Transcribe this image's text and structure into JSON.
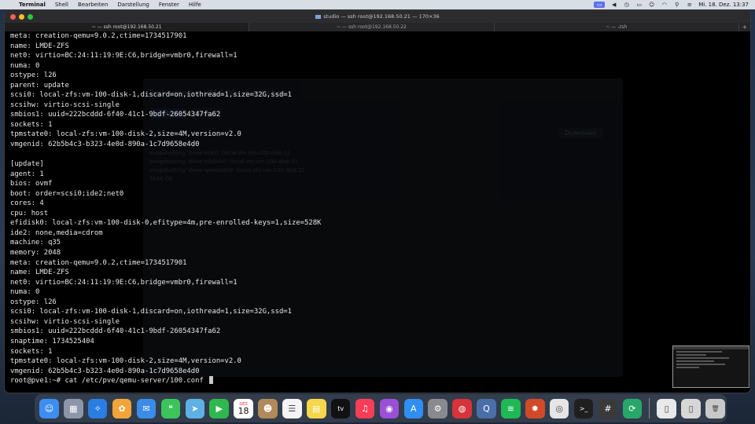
{
  "menubar": {
    "app_name": "Terminal",
    "items": [
      "Shell",
      "Bearbeiten",
      "Darstellung",
      "Fenster",
      "Hilfe"
    ],
    "clock": "Mi. 18. Dez. 13:37"
  },
  "window": {
    "title": "studio — ssh root@192.168.50.21 — 170×36",
    "tabs": [
      {
        "label": "~ — ssh root@192.168.50.21",
        "active": true
      },
      {
        "label": "~ — ssh root@192.168.50.22",
        "active": false
      },
      {
        "label": "~ — -zsh",
        "active": false
      }
    ]
  },
  "ghost": {
    "dialog_title": "Task viewer: VM 100 - Snapshot",
    "tab_output": "Output",
    "tab_status": "Status",
    "download": "Download",
    "log": [
      "snapshotting 'drive-scsi0' (local-zfs:vm-100-disk-1)",
      "snapshotting 'drive-efidisk0' (local-zfs:vm-100-disk-0)",
      "snapshotting 'drive-tpmstate0' (local-zfs:vm-100-disk-2)",
      "TASK OK"
    ]
  },
  "terminal": {
    "lines": [
      "meta: creation-qemu=9.0.2,ctime=1734517901",
      "name: LMDE-ZFS",
      "net0: virtio=BC:24:11:19:9E:C6,bridge=vmbr0,firewall=1",
      "numa: 0",
      "ostype: l26",
      "parent: update",
      "scsi0: local-zfs:vm-100-disk-1,discard=on,iothread=1,size=32G,ssd=1",
      "scsihw: virtio-scsi-single",
      "smbios1: uuid=222bcddd-6f40-41c1-9bdf-26054347fa62",
      "sockets: 1",
      "tpmstate0: local-zfs:vm-100-disk-2,size=4M,version=v2.0",
      "vmgenid: 62b5b4c3-b323-4e0d-890a-1c7d9658e4d0",
      "",
      "[update]",
      "agent: 1",
      "bios: ovmf",
      "boot: order=scsi0;ide2;net0",
      "cores: 4",
      "cpu: host",
      "efidisk0: local-zfs:vm-100-disk-0,efitype=4m,pre-enrolled-keys=1,size=528K",
      "ide2: none,media=cdrom",
      "machine: q35",
      "memory: 2048",
      "meta: creation-qemu=9.0.2,ctime=1734517901",
      "name: LMDE-ZFS",
      "net0: virtio=BC:24:11:19:9E:C6,bridge=vmbr0,firewall=1",
      "numa: 0",
      "ostype: l26",
      "scsi0: local-zfs:vm-100-disk-1,discard=on,iothread=1,size=32G,ssd=1",
      "scsihw: virtio-scsi-single",
      "smbios1: uuid=222bcddd-6f40-41c1-9bdf-26054347fa62",
      "snaptime: 1734525404",
      "sockets: 1",
      "tpmstate0: local-zfs:vm-100-disk-2,size=4M,version=v2.0",
      "vmgenid: 62b5b4c3-b323-4e0d-890a-1c7d9658e4d0"
    ],
    "prompt": "root@pve1:~# cat /etc/pve/qemu-server/100.conf "
  },
  "dock": {
    "calendar_month": "DEZ",
    "calendar_day": "18",
    "apps": [
      {
        "name": "finder-icon",
        "color": "#3d8ef0",
        "glyph": "☺"
      },
      {
        "name": "launchpad-icon",
        "color": "#8d96a8",
        "glyph": "▦"
      },
      {
        "name": "safari-icon",
        "color": "#2a7de1",
        "glyph": "✧"
      },
      {
        "name": "photos-icon",
        "color": "#f0a43a",
        "glyph": "✿"
      },
      {
        "name": "mail-icon",
        "color": "#3b8ce8",
        "glyph": "✉"
      },
      {
        "name": "messages-icon",
        "color": "#3ac45a",
        "glyph": "❝"
      },
      {
        "name": "maps-icon",
        "color": "#5fb0e6",
        "glyph": "➤"
      },
      {
        "name": "facetime-icon",
        "color": "#2fb84e",
        "glyph": "▶"
      },
      {
        "name": "calendar-icon",
        "color": "#ffffff",
        "glyph": ""
      },
      {
        "name": "contacts-icon",
        "color": "#b08a5a",
        "glyph": "☻"
      },
      {
        "name": "reminders-icon",
        "color": "#f4f4f4",
        "glyph": "☰"
      },
      {
        "name": "notes-icon",
        "color": "#f6d64a",
        "glyph": "▤"
      },
      {
        "name": "appletv-icon",
        "color": "#111111",
        "glyph": "tv"
      },
      {
        "name": "music-icon",
        "color": "#fa3d56",
        "glyph": "♫"
      },
      {
        "name": "podcasts-icon",
        "color": "#9b4fd6",
        "glyph": "◉"
      },
      {
        "name": "appstore-icon",
        "color": "#2f8ef2",
        "glyph": "A"
      },
      {
        "name": "settings-icon",
        "color": "#8a8a8e",
        "glyph": "⚙"
      },
      {
        "name": "vpn-icon",
        "color": "#d6333a",
        "glyph": "◍"
      },
      {
        "name": "quicktime-icon",
        "color": "#4a6fa8",
        "glyph": "Q"
      },
      {
        "name": "spotify-icon",
        "color": "#1db954",
        "glyph": "≋"
      },
      {
        "name": "game-icon",
        "color": "#d04a2a",
        "glyph": "✹"
      },
      {
        "name": "chrome-icon",
        "color": "#e5e5e5",
        "glyph": "◎"
      },
      {
        "name": "terminal-icon",
        "color": "#1f1f1f",
        "glyph": ">_"
      },
      {
        "name": "calculator-icon",
        "color": "#3a3a3a",
        "glyph": "#"
      },
      {
        "name": "sync-icon",
        "color": "#27a86a",
        "glyph": "⟳"
      }
    ],
    "trailing": [
      {
        "name": "documents-stack-icon",
        "color": "#e9e9e9",
        "glyph": "▯"
      },
      {
        "name": "downloads-stack-icon",
        "color": "#d7d7d7",
        "glyph": "▯"
      },
      {
        "name": "trash-icon",
        "color": "#c8c8c8",
        "glyph": "🗑"
      }
    ]
  }
}
